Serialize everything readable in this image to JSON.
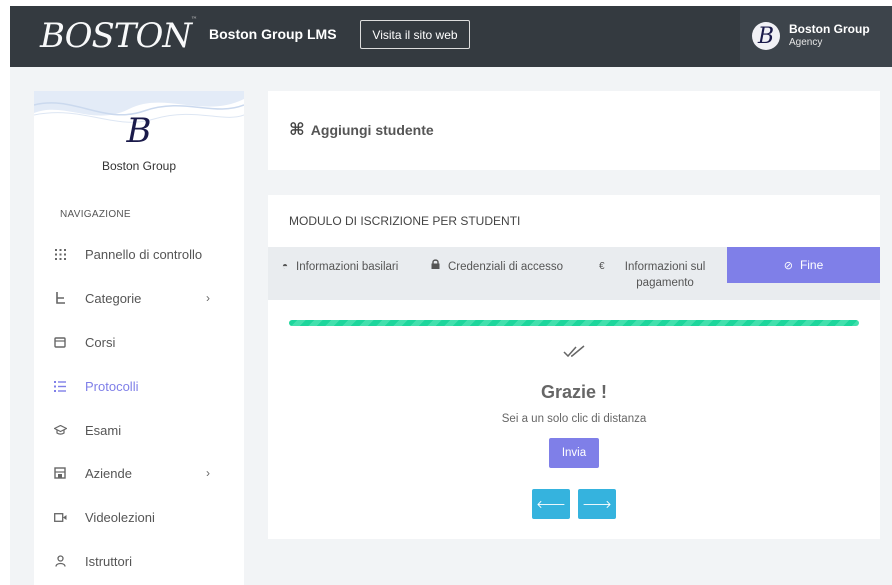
{
  "header": {
    "logo_text": "BOSTON",
    "app_title": "Boston Group LMS",
    "visit_label": "Visita il sito web",
    "user_name": "Boston Group",
    "user_sub": "Agency"
  },
  "sidebar": {
    "org_name": "Boston Group",
    "nav_heading": "NAVIGAZIONE",
    "items": [
      {
        "label": "Pannello di controllo",
        "icon": "grid-icon"
      },
      {
        "label": "Categorie",
        "icon": "tree-icon",
        "has_children": true
      },
      {
        "label": "Corsi",
        "icon": "book-icon"
      },
      {
        "label": "Protocolli",
        "icon": "list-icon",
        "active": true
      },
      {
        "label": "Esami",
        "icon": "graduation-cap-icon"
      },
      {
        "label": "Aziende",
        "icon": "building-icon",
        "has_children": true
      },
      {
        "label": "Videolezioni",
        "icon": "video-icon"
      },
      {
        "label": "Istruttori",
        "icon": "user-icon"
      }
    ]
  },
  "page": {
    "title": "Aggiungi studente"
  },
  "form": {
    "title": "MODULO DI ISCRIZIONE PER STUDENTI",
    "steps": [
      {
        "label": "Informazioni basilari",
        "icon": "info-icon"
      },
      {
        "label": "Credenziali di accesso",
        "icon": "lock-icon"
      },
      {
        "label": "Informazioni sul pagamento",
        "icon": "euro-icon"
      },
      {
        "label": "Fine",
        "icon": "check-circle-icon",
        "active": true
      }
    ],
    "progress_percent": 100,
    "thanks": "Grazie !",
    "subtitle": "Sei a un solo clic di distanza",
    "submit_label": "Invia"
  },
  "colors": {
    "header_bg": "#343a40",
    "accent": "#7f7fe8",
    "progress": "#1dd69c",
    "nav_button": "#35b3de",
    "backdrop": "#f2f4f6"
  }
}
